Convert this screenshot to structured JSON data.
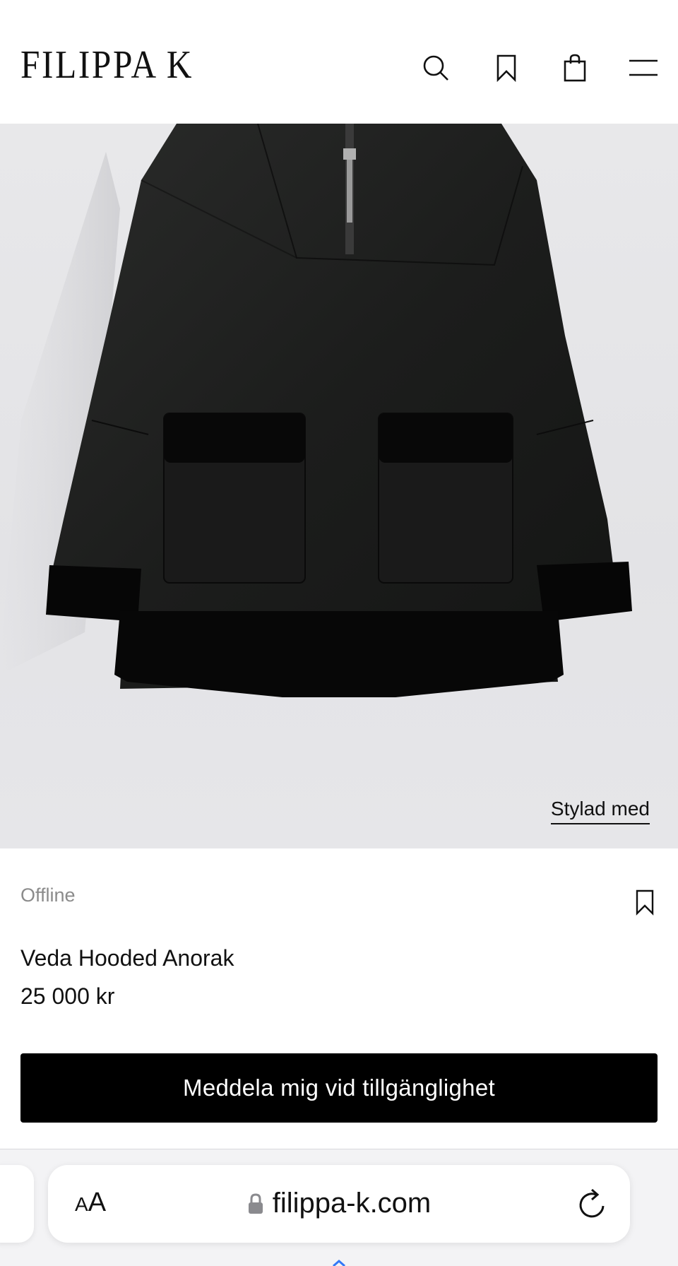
{
  "header": {
    "brand": "FILIPPA K",
    "icons": [
      "search-icon",
      "bookmark-icon",
      "shopping-bag-icon",
      "menu-icon"
    ]
  },
  "product": {
    "image_link": "Stylad med",
    "status": "Offline",
    "name": "Veda Hooded Anorak",
    "price": "25 000 kr",
    "notify_button": "Meddela mig vid tillgänglighet"
  },
  "browser": {
    "text_size_label_small": "A",
    "text_size_label_large": "A",
    "url": "filippa-k.com"
  },
  "colors": {
    "button_bg": "#000000",
    "button_text": "#ffffff",
    "status_text": "#8b8b8b",
    "image_bg": "#e6e6e9"
  }
}
